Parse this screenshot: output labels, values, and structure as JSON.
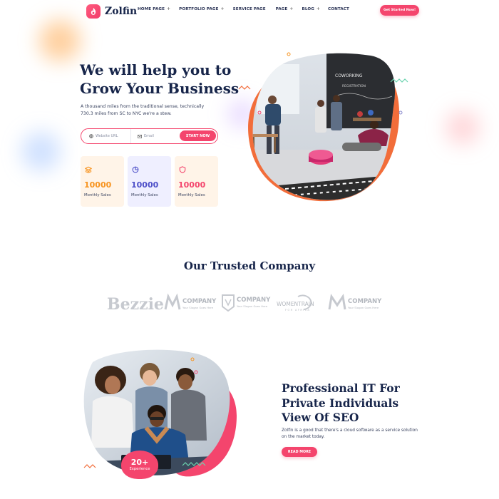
{
  "brand": {
    "name": "Zolfin"
  },
  "nav": {
    "items": [
      {
        "label": "HOME PAGE",
        "has_submenu": true
      },
      {
        "label": "PORTFOLIO PAGE",
        "has_submenu": true
      },
      {
        "label": "SERVICE PAGE",
        "has_submenu": false
      },
      {
        "label": "PAGE",
        "has_submenu": true
      },
      {
        "label": "BLOG",
        "has_submenu": true
      },
      {
        "label": "CONTACT",
        "has_submenu": false
      }
    ],
    "cta_label": "Get Started Now!"
  },
  "hero": {
    "title_line1": "We will help you to",
    "title_line2": "Grow Your Business",
    "description": "A thousand miles from the traditional sense, technically 730.3 miles from SC to NYC we're a stew.",
    "website_placeholder": "Website URL",
    "email_placeholder": "Email",
    "submit_label": "START NOW"
  },
  "stats": [
    {
      "value": "10000",
      "label": "Monthly Sales",
      "color": "#f7931e",
      "icon": "stack-icon"
    },
    {
      "value": "10000",
      "label": "Monthly Sales",
      "color": "#4d4fc8",
      "icon": "pie-chart-icon"
    },
    {
      "value": "10000",
      "label": "Monthly Sales",
      "color": "#f4456d",
      "icon": "shield-icon"
    }
  ],
  "trusted": {
    "title": "Our Trusted Company",
    "brands": [
      {
        "name": "Bezzie",
        "tagline": ""
      },
      {
        "name": "COMPANY",
        "tagline": "Your Slogan Goes Here"
      },
      {
        "name": "COMPANY",
        "tagline": "Your Slogan Goes Here"
      },
      {
        "name": "WOMENTRAIN",
        "tagline": "FOR AFRICA"
      },
      {
        "name": "COMPANY",
        "tagline": "Your Slogan Goes Here"
      }
    ]
  },
  "about": {
    "title_line1": "Professional IT For",
    "title_line2": "Private Individuals",
    "title_line3": "View Of SEO",
    "description": "Zolfin is a good that there's a cloud software as a service solution on the market today.",
    "button_label": "READ MORE",
    "experience_value": "20+",
    "experience_label": "Experience"
  },
  "colors": {
    "primary": "#f4456d",
    "orange": "#f7931e",
    "navy": "#17254a",
    "purple": "#4d4fc8"
  }
}
